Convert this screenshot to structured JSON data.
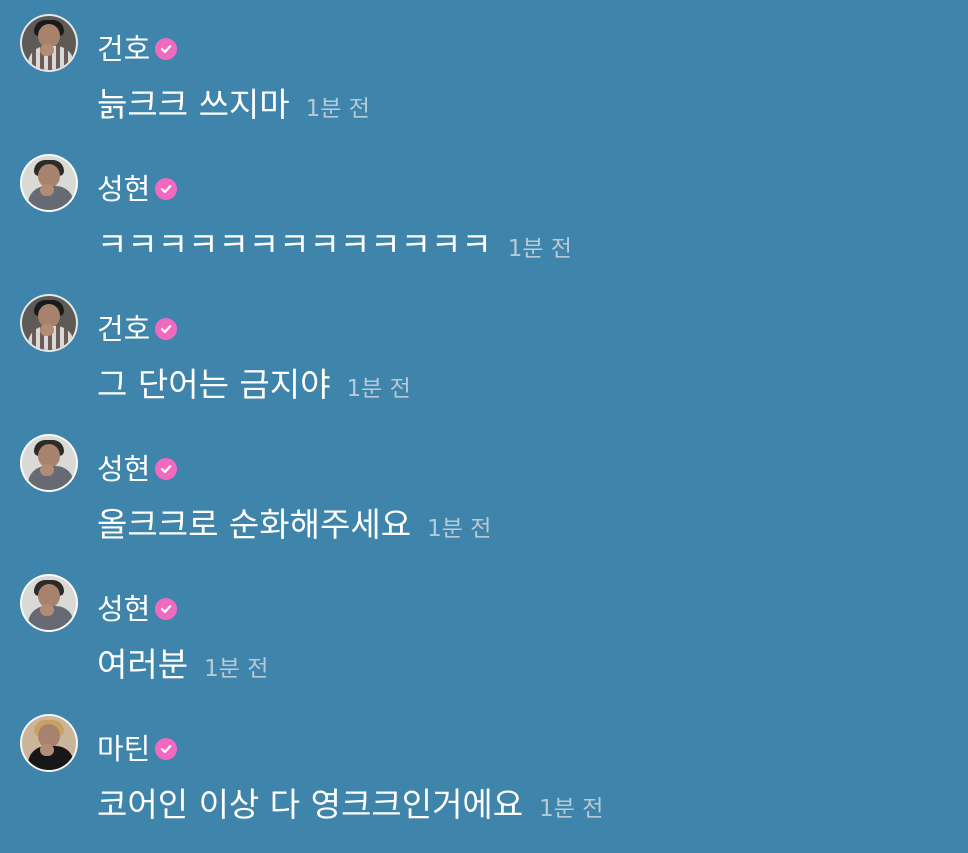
{
  "messages": [
    {
      "author": "건호",
      "avatar_icon": "profile-photo-geonho",
      "verified_icon": "pink-verified-check-badge-icon",
      "text": "늙크크 쓰지마",
      "time": "1분 전"
    },
    {
      "author": "성현",
      "avatar_icon": "profile-photo-seonghyun",
      "verified_icon": "pink-verified-check-badge-icon",
      "text": "ㅋㅋㅋㅋㅋㅋㅋㅋㅋㅋㅋㅋㅋ",
      "time": "1분 전"
    },
    {
      "author": "건호",
      "avatar_icon": "profile-photo-geonho",
      "verified_icon": "pink-verified-check-badge-icon",
      "text": "그 단어는 금지야",
      "time": "1분 전"
    },
    {
      "author": "성현",
      "avatar_icon": "profile-photo-seonghyun",
      "verified_icon": "pink-verified-check-badge-icon",
      "text": "올크크로 순화해주세요",
      "time": "1분 전"
    },
    {
      "author": "성현",
      "avatar_icon": "profile-photo-seonghyun",
      "verified_icon": "pink-verified-check-badge-icon",
      "text": "여러분",
      "time": "1분 전"
    },
    {
      "author": "마틴",
      "avatar_icon": "profile-photo-martin",
      "verified_icon": "pink-verified-check-badge-icon",
      "text": "코어인 이상 다 영크크인거에요",
      "time": "1분 전"
    }
  ],
  "colors": {
    "background": "#3f84aa",
    "text": "#ffffff",
    "timestamp": "#b8cad6",
    "verified_badge": "#f16ac0"
  }
}
